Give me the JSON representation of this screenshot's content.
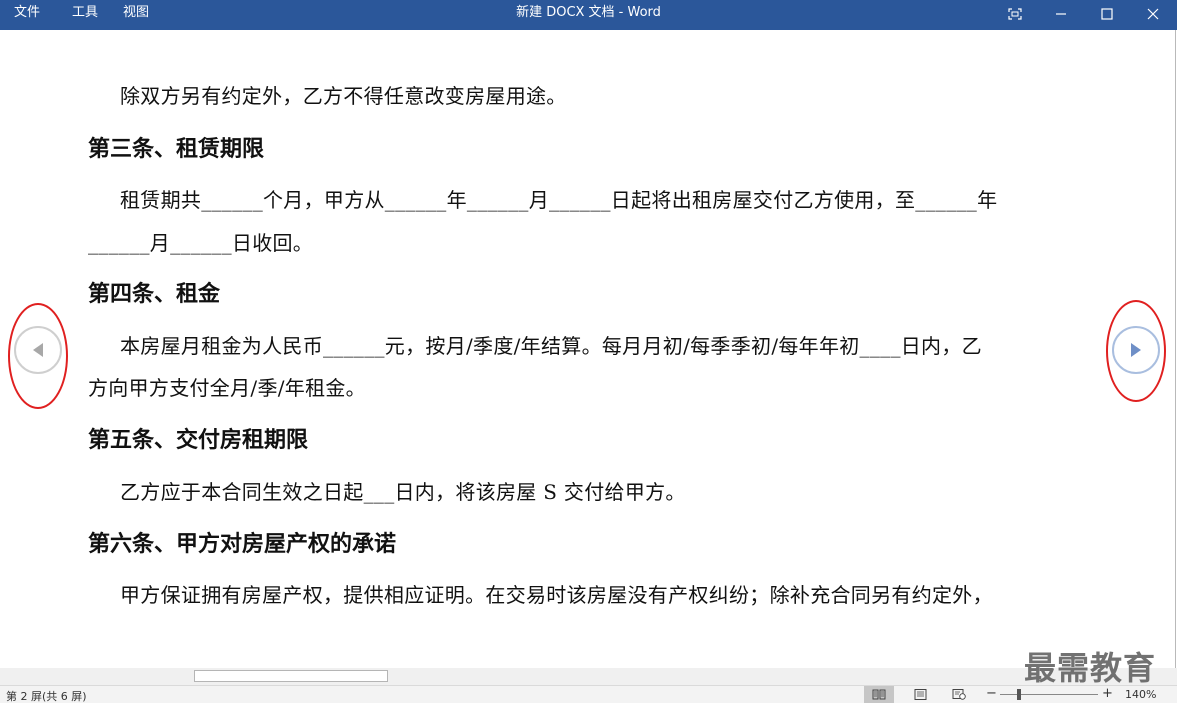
{
  "titlebar": {
    "menu": [
      "文件",
      "工具",
      "视图"
    ],
    "title": "新建 DOCX 文档  -  Word"
  },
  "document": {
    "paragraphs": [
      "除双方另有约定外，乙方不得任意改变房屋用途。",
      "第三条、租赁期限",
      "租赁期共______个月，甲方从______年______月______日起将出租房屋交付乙方使用，至______年",
      "______月______日收回。",
      "第四条、租金",
      "本房屋月租金为人民币______元，按月/季度/年结算。每月月初/每季季初/每年年初____日内，乙",
      "方向甲方支付全月/季/年租金。",
      "第五条、交付房租期限",
      "乙方应于本合同生效之日起___日内，将该房屋 S 交付给甲方。",
      "第六条、甲方对房屋产权的承诺",
      "甲方保证拥有房屋产权，提供相应证明。在交易时该房屋没有产权纠纷；除补充合同另有约定外，"
    ]
  },
  "navigation": {
    "prev_icon": "triangle-left-icon",
    "next_icon": "triangle-right-icon"
  },
  "statusbar": {
    "page_info": "第 2 屏(共 6 屏)",
    "zoom_minus": "−",
    "zoom_plus": "+",
    "zoom_percent": "140%"
  },
  "watermark": "最需教育",
  "colors": {
    "titlebar": "#2b579a",
    "highlight_ring": "#e02020",
    "next_arrow": "#6f8fc7",
    "prev_arrow": "#a8a8a8"
  }
}
